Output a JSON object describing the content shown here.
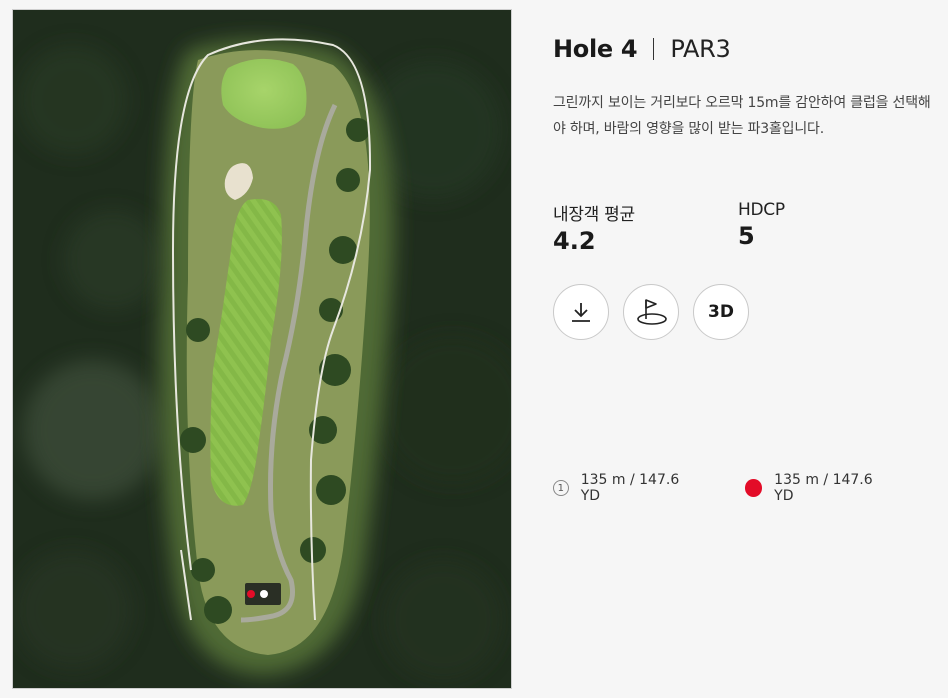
{
  "hole": {
    "title": "Hole 4",
    "par": "PAR3",
    "description": "그린까지 보이는 거리보다 오르막 15m를 감안하여 클럽을 선택해야 하며, 바람의 영향을 많이 받는 파3홀입니다."
  },
  "stats": {
    "avg_label": "내장객 평균",
    "avg_value": "4.2",
    "hdcp_label": "HDCP",
    "hdcp_value": "5"
  },
  "buttons": {
    "download_icon": "download-icon",
    "flag_icon": "golf-flag-icon",
    "three_d_label": "3D"
  },
  "tees": [
    {
      "marker": "1",
      "distance": "135 m / 147.6 YD",
      "color": "#e30c28"
    },
    {
      "marker": "",
      "distance": "135 m / 147.6 YD",
      "color": "#e30c28"
    }
  ],
  "colors": {
    "tee_red": "#e30c28",
    "tee_white": "#ffffff"
  }
}
